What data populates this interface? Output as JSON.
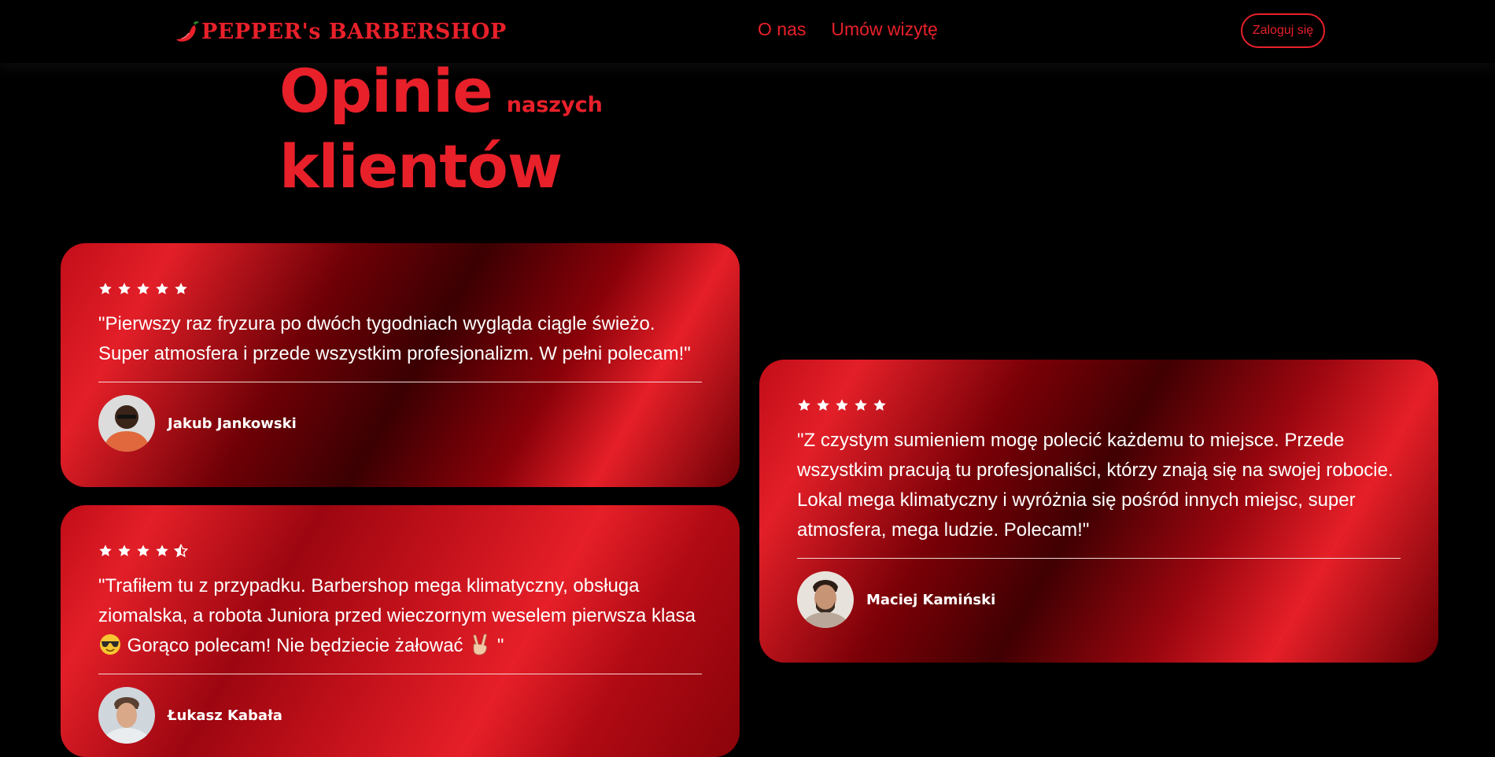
{
  "nav": {
    "logo_text": "PEPPER's BARBERSHOP",
    "links": [
      "O nas",
      "Umów wizytę"
    ],
    "login_label": "Zaloguj się"
  },
  "heading": {
    "word1": "Opinie",
    "word2": "naszych",
    "word3": "klientów"
  },
  "reviews": [
    {
      "rating": 5,
      "quote": "\"Pierwszy raz fryzura po dwóch tygodniach wygląda ciągle świeżo. Super atmosfera i przede wszystkim profesjonalizm. W pełni polecam!\"",
      "author": "Jakub Jankowski"
    },
    {
      "rating": 5,
      "quote": "\"Z czystym sumieniem mogę polecić każdemu to miejsce. Przede wszystkim pracują tu profesjonaliści, którzy znają się na swojej robocie. Lokal mega klimatyczny i wyróżnia się pośród innych miejsc, super atmosfera, mega ludzie. Polecam!\"",
      "author": "Maciej Kamiński"
    },
    {
      "rating": 4.5,
      "quote_part1": "\"Trafiłem tu z przypadku. Barbershop mega klimatyczny, obsługa ziomalska, a robota Juniora przed wieczornym weselem pierwsza klasa",
      "quote_part2": " Gorąco polecam! Nie będziecie żałować ",
      "quote_part3": " \"",
      "author": "Łukasz Kabała"
    }
  ],
  "colors": {
    "brand_red": "#e8202a",
    "background": "#000000"
  }
}
